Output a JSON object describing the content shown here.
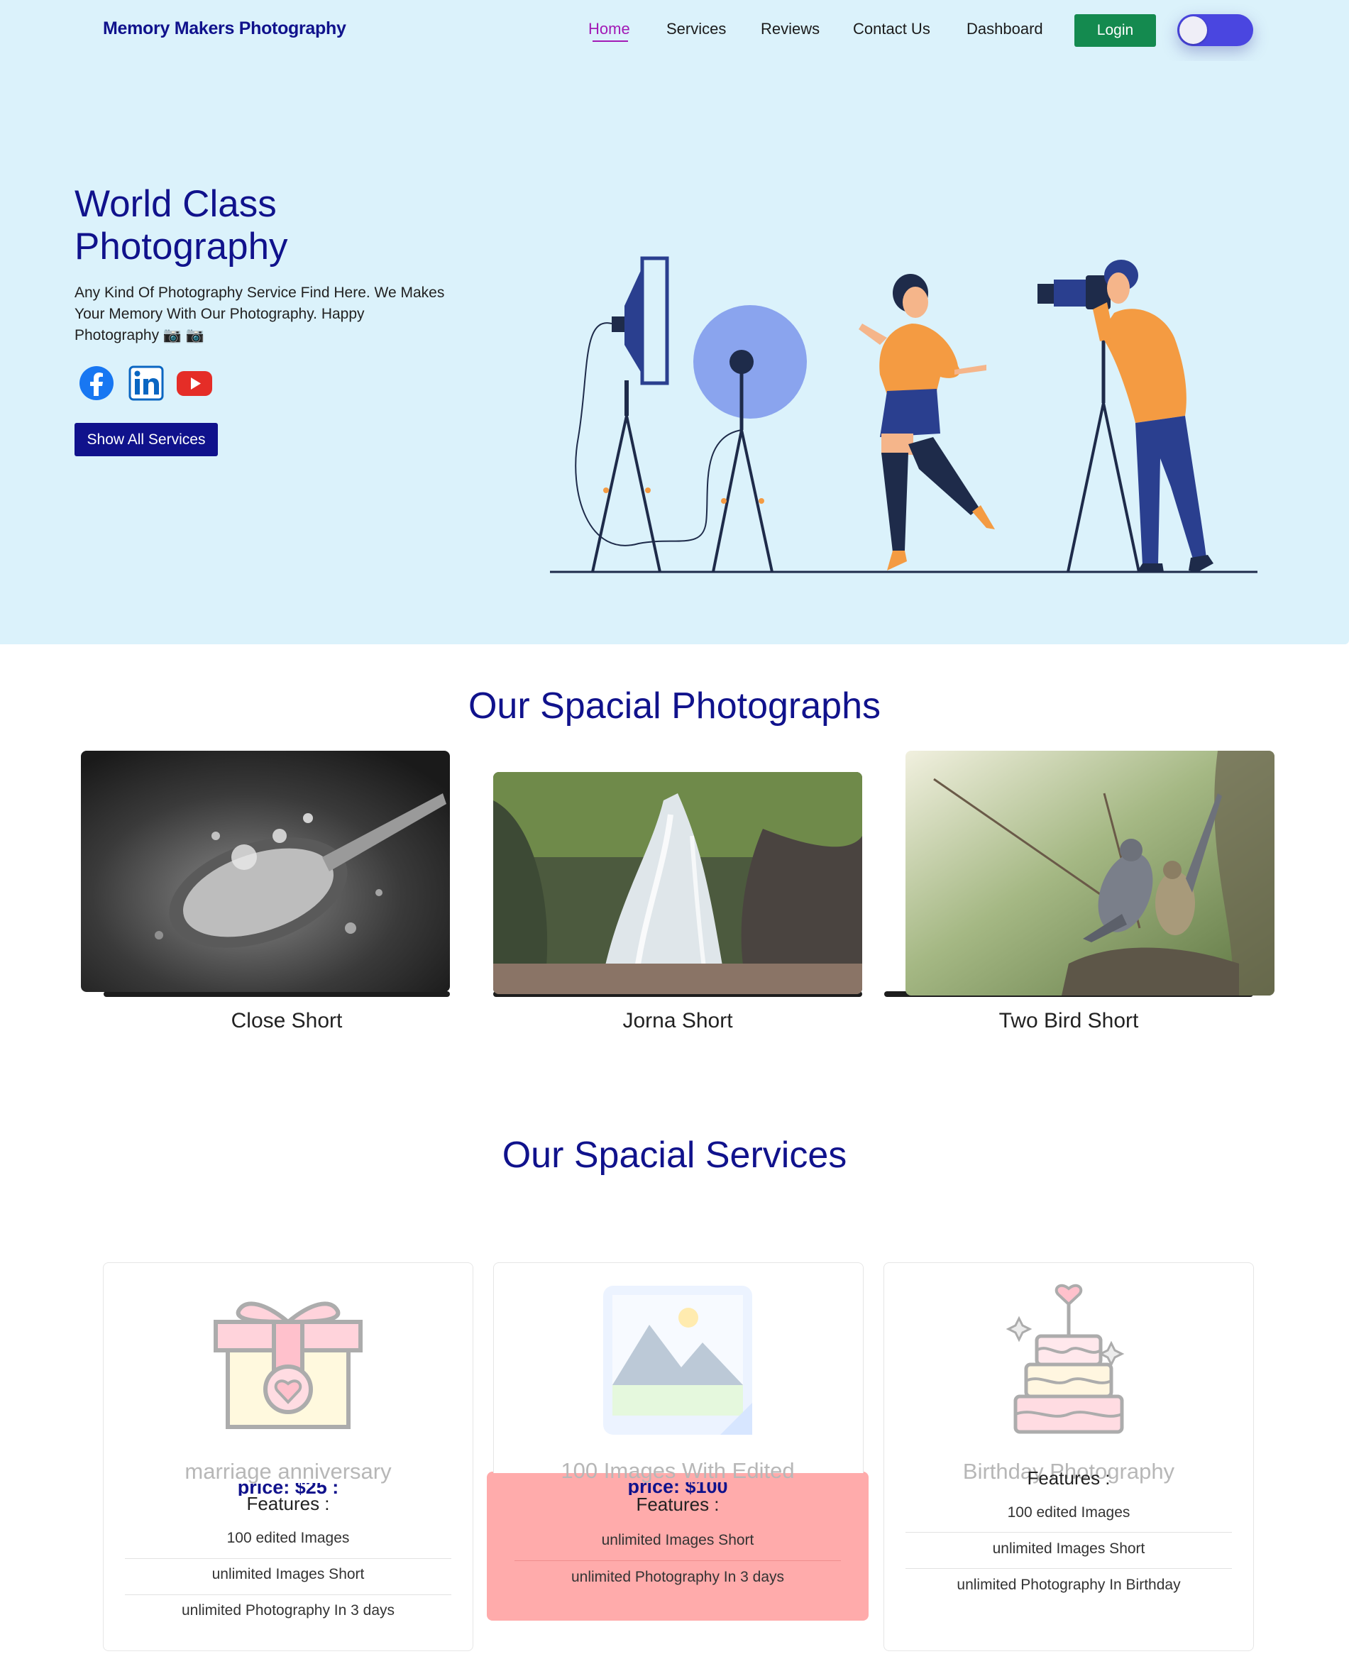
{
  "nav": {
    "brand": "Memory Makers Photography",
    "links": [
      "Home",
      "Services",
      "Reviews",
      "Contact Us",
      "Dashboard"
    ],
    "login_label": "Login"
  },
  "hero": {
    "title": "World Class Photography",
    "text": "Any Kind Of Photography Service Find Here. We Makes Your Memory With Our Photography. Happy Photography 📷 📷",
    "cta_label": "Show All Services",
    "social_icons": [
      "facebook-icon",
      "linkedin-icon",
      "youtube-icon"
    ]
  },
  "gallery": {
    "title": "Our Spacial Photographs",
    "items": [
      {
        "caption": "Close Short"
      },
      {
        "caption": "Jorna Short"
      },
      {
        "caption": "Two Bird Short"
      }
    ]
  },
  "services": {
    "title": "Our Spacial Services",
    "items": [
      {
        "name": "marriage anniversary",
        "price": "price: $25 :",
        "features_label": "Features :",
        "features": [
          "100 edited Images",
          "unlimited Images Short",
          "unlimited Photography In 3 days"
        ]
      },
      {
        "name": "100 Images With Edited",
        "price": "price: $100",
        "features_label": "Features :",
        "features": [
          "unlimited Images Short",
          "unlimited Photography In 3 days"
        ]
      },
      {
        "name": "Birthday Photography",
        "features_label": "Features :",
        "features": [
          "100 edited Images",
          "unlimited Images Short",
          "unlimited Photography In Birthday"
        ]
      }
    ]
  },
  "colors": {
    "brand_navy": "#10128c",
    "hero_bg": "#dbf2fb",
    "active_link": "#a21ab5",
    "login_green": "#148a4f",
    "toggle_purple": "#4a46e0",
    "highlight_card": "#ffabab"
  }
}
